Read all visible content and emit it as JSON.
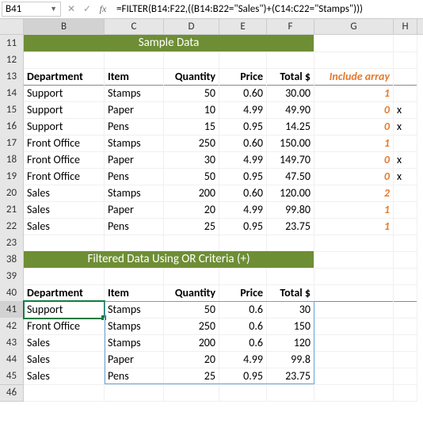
{
  "nameBox": "B41",
  "formula": "=FILTER(B14:F22,((B14:B22=\"Sales\")+(C14:C22=\"Stamps\")))",
  "columns": [
    "B",
    "C",
    "D",
    "E",
    "F",
    "G",
    "H"
  ],
  "section1Title": "Sample Data",
  "section2Title": "Filtered Data Using OR Criteria (+)",
  "headers": {
    "dept": "Department",
    "item": "Item",
    "qty": "Quantity",
    "price": "Price",
    "total": "Total $",
    "include": "Include array"
  },
  "rows": [
    {
      "r": "14",
      "dept": "Support",
      "item": "Stamps",
      "qty": "50",
      "price": "0.60",
      "total": "30.00",
      "inc": "1",
      "x": ""
    },
    {
      "r": "15",
      "dept": "Support",
      "item": "Paper",
      "qty": "10",
      "price": "4.99",
      "total": "49.90",
      "inc": "0",
      "x": "x"
    },
    {
      "r": "16",
      "dept": "Support",
      "item": "Pens",
      "qty": "15",
      "price": "0.95",
      "total": "14.25",
      "inc": "0",
      "x": "x"
    },
    {
      "r": "17",
      "dept": "Front Office",
      "item": "Stamps",
      "qty": "250",
      "price": "0.60",
      "total": "150.00",
      "inc": "1",
      "x": ""
    },
    {
      "r": "18",
      "dept": "Front Office",
      "item": "Paper",
      "qty": "30",
      "price": "4.99",
      "total": "149.70",
      "inc": "0",
      "x": "x"
    },
    {
      "r": "19",
      "dept": "Front Office",
      "item": "Pens",
      "qty": "50",
      "price": "0.95",
      "total": "47.50",
      "inc": "0",
      "x": "x"
    },
    {
      "r": "20",
      "dept": "Sales",
      "item": "Stamps",
      "qty": "200",
      "price": "0.60",
      "total": "120.00",
      "inc": "2",
      "x": ""
    },
    {
      "r": "21",
      "dept": "Sales",
      "item": "Paper",
      "qty": "20",
      "price": "4.99",
      "total": "99.80",
      "inc": "1",
      "x": ""
    },
    {
      "r": "22",
      "dept": "Sales",
      "item": "Pens",
      "qty": "25",
      "price": "0.95",
      "total": "23.75",
      "inc": "1",
      "x": ""
    }
  ],
  "chart_data": {
    "type": "table",
    "title": "Filtered Data Using OR Criteria (+)",
    "columns": [
      "Department",
      "Item",
      "Quantity",
      "Price",
      "Total $"
    ],
    "rows": [
      [
        "Support",
        "Stamps",
        50,
        0.6,
        30
      ],
      [
        "Front Office",
        "Stamps",
        250,
        0.6,
        150
      ],
      [
        "Sales",
        "Stamps",
        200,
        0.6,
        120
      ],
      [
        "Sales",
        "Paper",
        20,
        4.99,
        99.8
      ],
      [
        "Sales",
        "Pens",
        25,
        0.95,
        23.75
      ]
    ]
  },
  "filteredRowNums": [
    "41",
    "42",
    "43",
    "44",
    "45"
  ]
}
